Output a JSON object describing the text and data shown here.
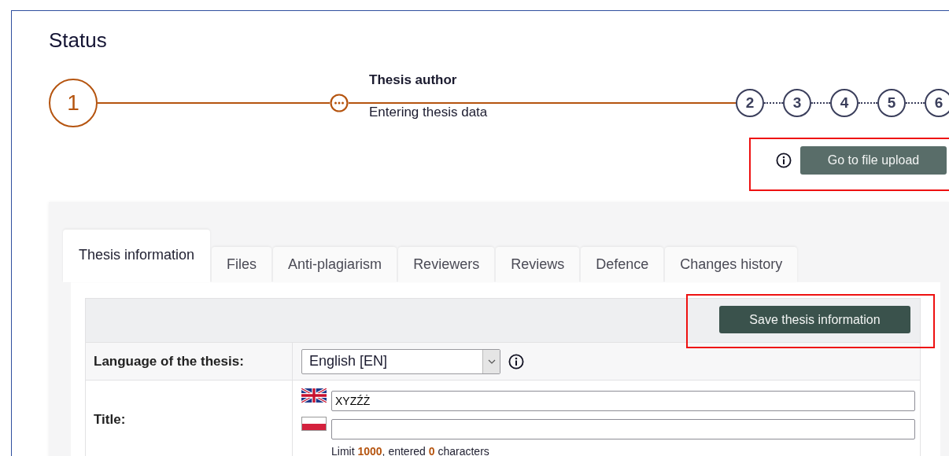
{
  "page_title": "Status",
  "stepper": {
    "steps": [
      {
        "number": "1",
        "completed": true
      },
      {
        "number": "2",
        "completed": false
      },
      {
        "number": "3",
        "completed": false
      },
      {
        "number": "4",
        "completed": false
      },
      {
        "number": "5",
        "completed": false
      },
      {
        "number": "6",
        "completed": false
      }
    ],
    "current_stage": {
      "title": "Thesis author",
      "subtitle": "Entering thesis data"
    }
  },
  "upload_button": {
    "label": "Go to file upload",
    "highlighted": true
  },
  "tabs": [
    {
      "label": "Thesis information",
      "selected": true
    },
    {
      "label": "Files",
      "selected": false
    },
    {
      "label": "Anti-plagiarism",
      "selected": false
    },
    {
      "label": "Reviewers",
      "selected": false
    },
    {
      "label": "Reviews",
      "selected": false
    },
    {
      "label": "Defence",
      "selected": false
    },
    {
      "label": "Changes history",
      "selected": false
    }
  ],
  "form": {
    "save_button": {
      "label": "Save thesis information",
      "highlighted": true
    },
    "rows": [
      {
        "kind": "select",
        "label": "Language of the thesis:",
        "value": "English [EN]"
      },
      {
        "kind": "multilang",
        "label": "Title:",
        "inputs": [
          {
            "kind": "english",
            "value": "XYZŹŻ"
          },
          {
            "kind": "polish"
          }
        ],
        "hint": "Limit **1000**, entered **0** characters"
      }
    ]
  }
}
